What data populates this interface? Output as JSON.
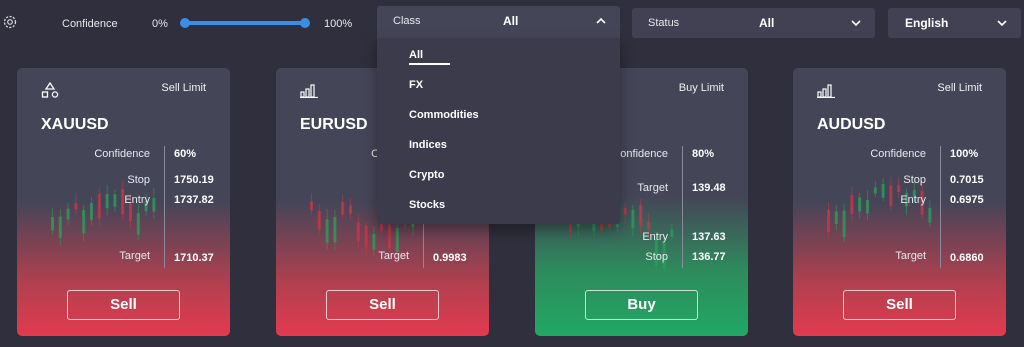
{
  "toolbar": {
    "confidence_label": "Confidence",
    "confidence_min": "0%",
    "confidence_max": "100%",
    "confidence_range": [
      0,
      100
    ],
    "class_label": "Class",
    "class_value": "All",
    "status_label": "Status",
    "status_value": "All",
    "language_value": "English"
  },
  "class_options": [
    "All",
    "FX",
    "Commodities",
    "Indices",
    "Crypto",
    "Stocks"
  ],
  "cards": [
    {
      "symbol": "XAUUSD",
      "order_type": "Sell Limit",
      "icon": "shapes-icon",
      "confidence_label": "Confidence",
      "confidence": "60%",
      "rows": [
        {
          "label": "Stop",
          "value": "1750.19"
        },
        {
          "label": "Entry",
          "value": "1737.82"
        },
        {
          "label": "Target",
          "value": "1710.37"
        }
      ],
      "action": "Sell"
    },
    {
      "symbol": "EURUSD",
      "order_type": "",
      "icon": "bar-chart-icon",
      "confidence_label": "Confide",
      "confidence": "",
      "rows": [
        {
          "label": "Target",
          "value": "0.9983"
        }
      ],
      "action": "Sell"
    },
    {
      "symbol": "",
      "order_type": "Buy Limit",
      "icon": "bar-chart-icon",
      "confidence_label": "onfidence",
      "confidence": "80%",
      "rows": [
        {
          "label": "Target",
          "value": "139.48"
        },
        {
          "label": "Entry",
          "value": "137.63"
        },
        {
          "label": "Stop",
          "value": "136.77"
        }
      ],
      "action": "Buy"
    },
    {
      "symbol": "AUDUSD",
      "order_type": "Sell Limit",
      "icon": "bar-chart-icon",
      "confidence_label": "Confidence",
      "confidence": "100%",
      "rows": [
        {
          "label": "Stop",
          "value": "0.7015"
        },
        {
          "label": "Entry",
          "value": "0.6975"
        },
        {
          "label": "Target",
          "value": "0.6860"
        }
      ],
      "action": "Sell"
    }
  ],
  "colors": {
    "background": "#2f2f3d",
    "panel": "#454558",
    "accent": "#3b8ee6",
    "sell": "#e33a4f",
    "buy": "#21a865",
    "candle_up": "#2a9d5c",
    "candle_down": "#c9364a"
  }
}
